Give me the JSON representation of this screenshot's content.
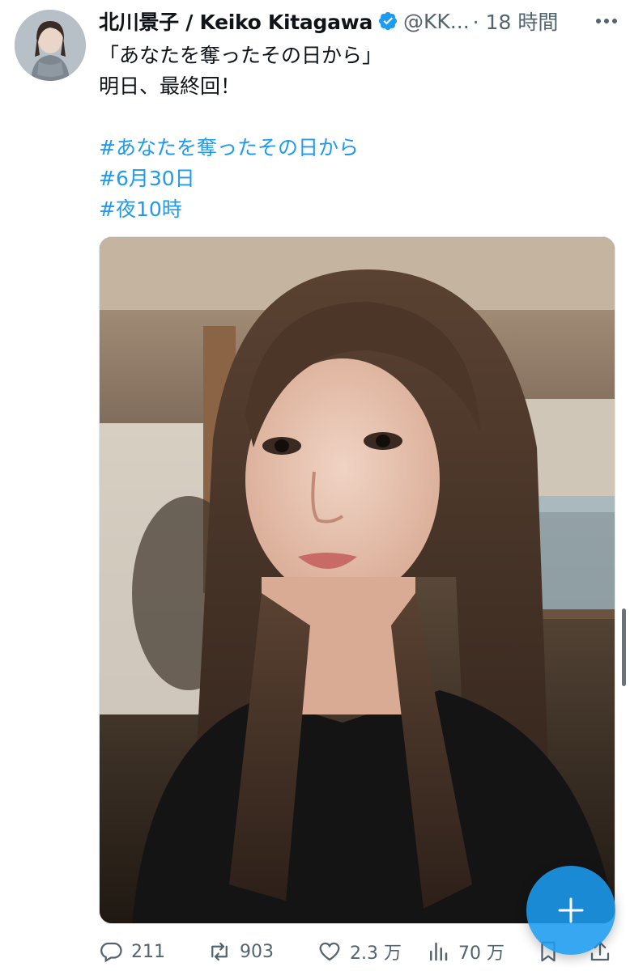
{
  "tweet": {
    "display_name": "北川景子 / Keiko Kitagawa",
    "handle": "@KK...",
    "time": "· 18 時間",
    "lines": [
      "「あなたを奪ったその日から」",
      "明日、最終回！",
      "",
      "#あなたを奪ったその日から",
      "#6月30日",
      "#夜10時"
    ]
  },
  "actions": {
    "replies": "211",
    "retweets": "903",
    "likes": "2.3 万",
    "views": "70 万"
  },
  "icons": {
    "verified": "verified-badge-icon",
    "reply": "reply-icon",
    "retweet": "retweet-icon",
    "like": "heart-icon",
    "views": "views-icon",
    "bookmark": "bookmark-icon",
    "share": "share-icon",
    "compose": "plus-icon",
    "more": "more-icon"
  },
  "colors": {
    "accent": "#1d9bf0",
    "secondary_text": "#536471",
    "text": "#0f1419"
  }
}
